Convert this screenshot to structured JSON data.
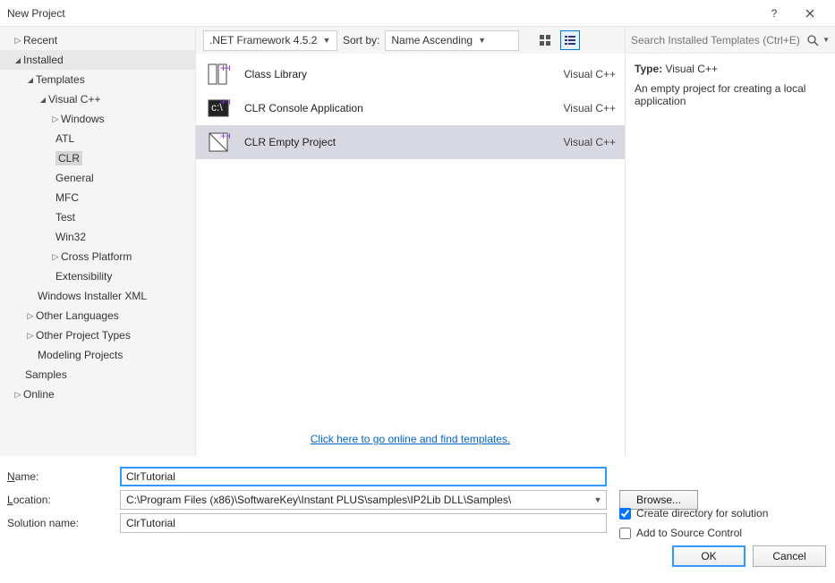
{
  "window": {
    "title": "New Project"
  },
  "sidebar": {
    "recent": "Recent",
    "installed": "Installed",
    "online": "Online",
    "templates": "Templates",
    "samples": "Samples",
    "visualcpp": "Visual C++",
    "windows": "Windows",
    "atl": "ATL",
    "clr": "CLR",
    "general": "General",
    "mfc": "MFC",
    "test": "Test",
    "win32": "Win32",
    "crossplatform": "Cross Platform",
    "extensibility": "Extensibility",
    "wix": "Windows Installer XML",
    "otherlang": "Other Languages",
    "otherproj": "Other Project Types",
    "modeling": "Modeling Projects"
  },
  "toolbar": {
    "framework": ".NET Framework 4.5.2",
    "sortby_label": "Sort by:",
    "sortby_value": "Name Ascending"
  },
  "templates": [
    {
      "name": "Class Library",
      "lang": "Visual C++"
    },
    {
      "name": "CLR Console Application",
      "lang": "Visual C++"
    },
    {
      "name": "CLR Empty Project",
      "lang": "Visual C++"
    }
  ],
  "online_link": "Click here to go online and find templates.",
  "search": {
    "placeholder": "Search Installed Templates (Ctrl+E)"
  },
  "details": {
    "type_label": "Type:",
    "type_value": "Visual C++",
    "description": "An empty project for creating a local application"
  },
  "form": {
    "name_label_u": "N",
    "name_label_rest": "ame:",
    "name_value": "ClrTutorial",
    "location_label_u": "L",
    "location_label_rest": "ocation:",
    "location_value": "C:\\Program Files (x86)\\SoftwareKey\\Instant PLUS\\samples\\IP2Lib DLL\\Samples\\",
    "solution_label": "Solution name:",
    "solution_value": "ClrTutorial",
    "browse_u": "B",
    "browse_rest": "rowse...",
    "chk_create": "Create directory for solution",
    "chk_scc": "Add to Source Control"
  },
  "buttons": {
    "ok": "OK",
    "cancel": "Cancel"
  }
}
